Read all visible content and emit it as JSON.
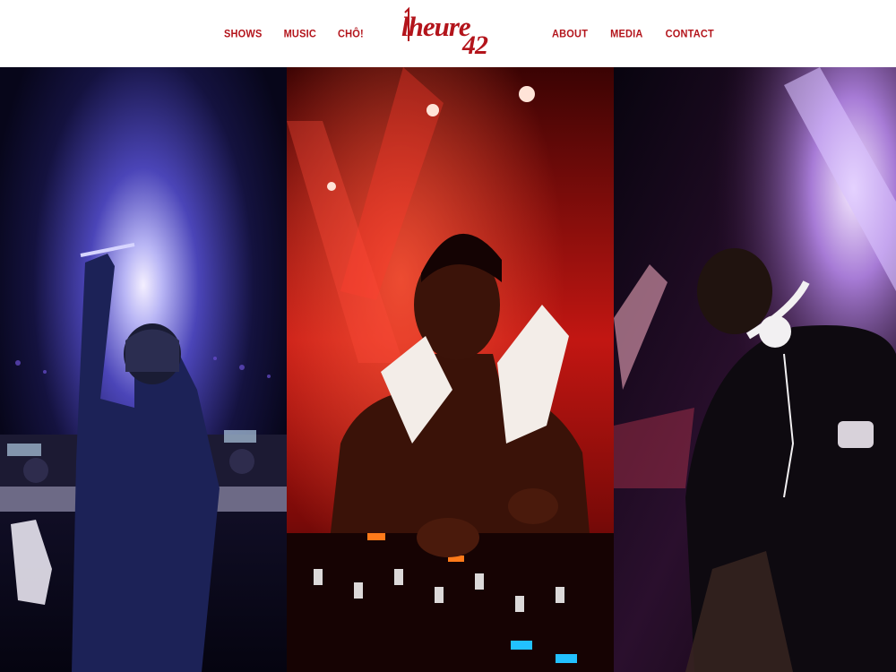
{
  "brand": {
    "logo_text": "l'heure 42",
    "accent_color": "#b3141b"
  },
  "nav": {
    "left": [
      "SHOWS",
      "MUSIC",
      "CHÔ!"
    ],
    "right": [
      "ABOUT",
      "MEDIA",
      "CONTACT"
    ]
  },
  "gallery": {
    "photos": [
      {
        "subject": "DJ performing from behind, arm raised under blue-violet stage lights",
        "palette": [
          "#0b0a2c",
          "#3a3aa0",
          "#e9e3ff"
        ]
      },
      {
        "subject": "DJ with towel on shoulders mixing on decks under red stage lights",
        "palette": [
          "#2a0000",
          "#e0201c",
          "#ffd2c4"
        ]
      },
      {
        "subject": "DJ with headphones around neck leaning over decks under purple lights",
        "palette": [
          "#0a0410",
          "#7a3aa0",
          "#f3e6ff"
        ]
      }
    ]
  }
}
